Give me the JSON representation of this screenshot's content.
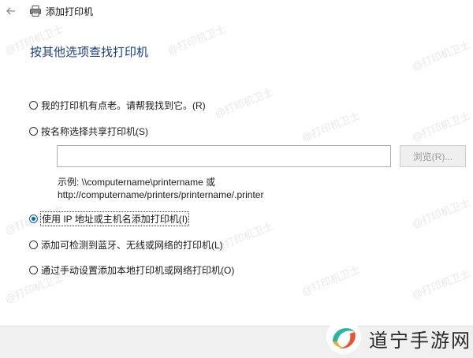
{
  "window": {
    "title": "添加打印机"
  },
  "page": {
    "heading": "按其他选项查找打印机"
  },
  "options": [
    {
      "label": "我的打印机有点老。请帮我找到它。(R)",
      "checked": false
    },
    {
      "label": "按名称选择共享打印机(S)",
      "checked": false
    },
    {
      "label": "使用 IP 地址或主机名添加打印机(I)",
      "checked": true
    },
    {
      "label": "添加可检测到蓝牙、无线或网络的打印机(L)",
      "checked": false
    },
    {
      "label": "通过手动设置添加本地打印机或网络打印机(O)",
      "checked": false
    }
  ],
  "share": {
    "input_value": "",
    "browse_label": "浏览(R)...",
    "example_line1": "示例: \\\\computername\\printername 或",
    "example_line2": "http://computername/printers/printername/.printer"
  },
  "watermark": {
    "text": "@打印机卫士"
  },
  "brand": {
    "text": "道宁手游网"
  },
  "icons": {
    "back": "back-arrow-icon",
    "printer": "printer-icon",
    "radio": "radio-button-icon",
    "brand_logo": "brand-logo-icon"
  },
  "colors": {
    "heading": "#1a3e8a",
    "radio_selected": "#0067c0",
    "footer_bg": "#f0f0f0",
    "browse_disabled_text": "#9b9b9b"
  }
}
